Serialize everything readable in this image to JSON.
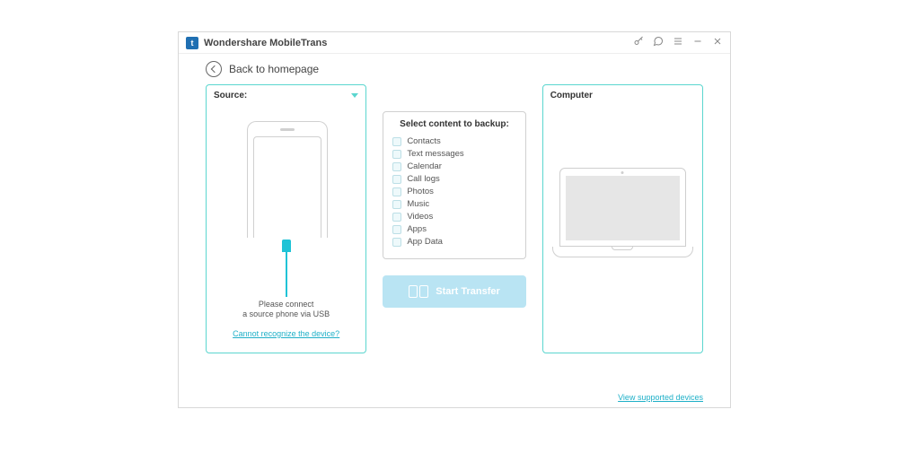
{
  "titlebar": {
    "app_icon_letter": "t",
    "title": "Wondershare MobileTrans"
  },
  "back": {
    "label": "Back to homepage"
  },
  "source_panel": {
    "header": "Source:",
    "message_line1": "Please connect",
    "message_line2": "a source phone via USB",
    "help_link": "Cannot recognize the device?"
  },
  "select": {
    "title": "Select content to backup:",
    "items": [
      "Contacts",
      "Text messages",
      "Calendar",
      "Call logs",
      "Photos",
      "Music",
      "Videos",
      "Apps",
      "App Data"
    ]
  },
  "transfer_button": {
    "label": "Start Transfer"
  },
  "dest_panel": {
    "header": "Computer"
  },
  "footer": {
    "supported_link": "View supported devices"
  }
}
